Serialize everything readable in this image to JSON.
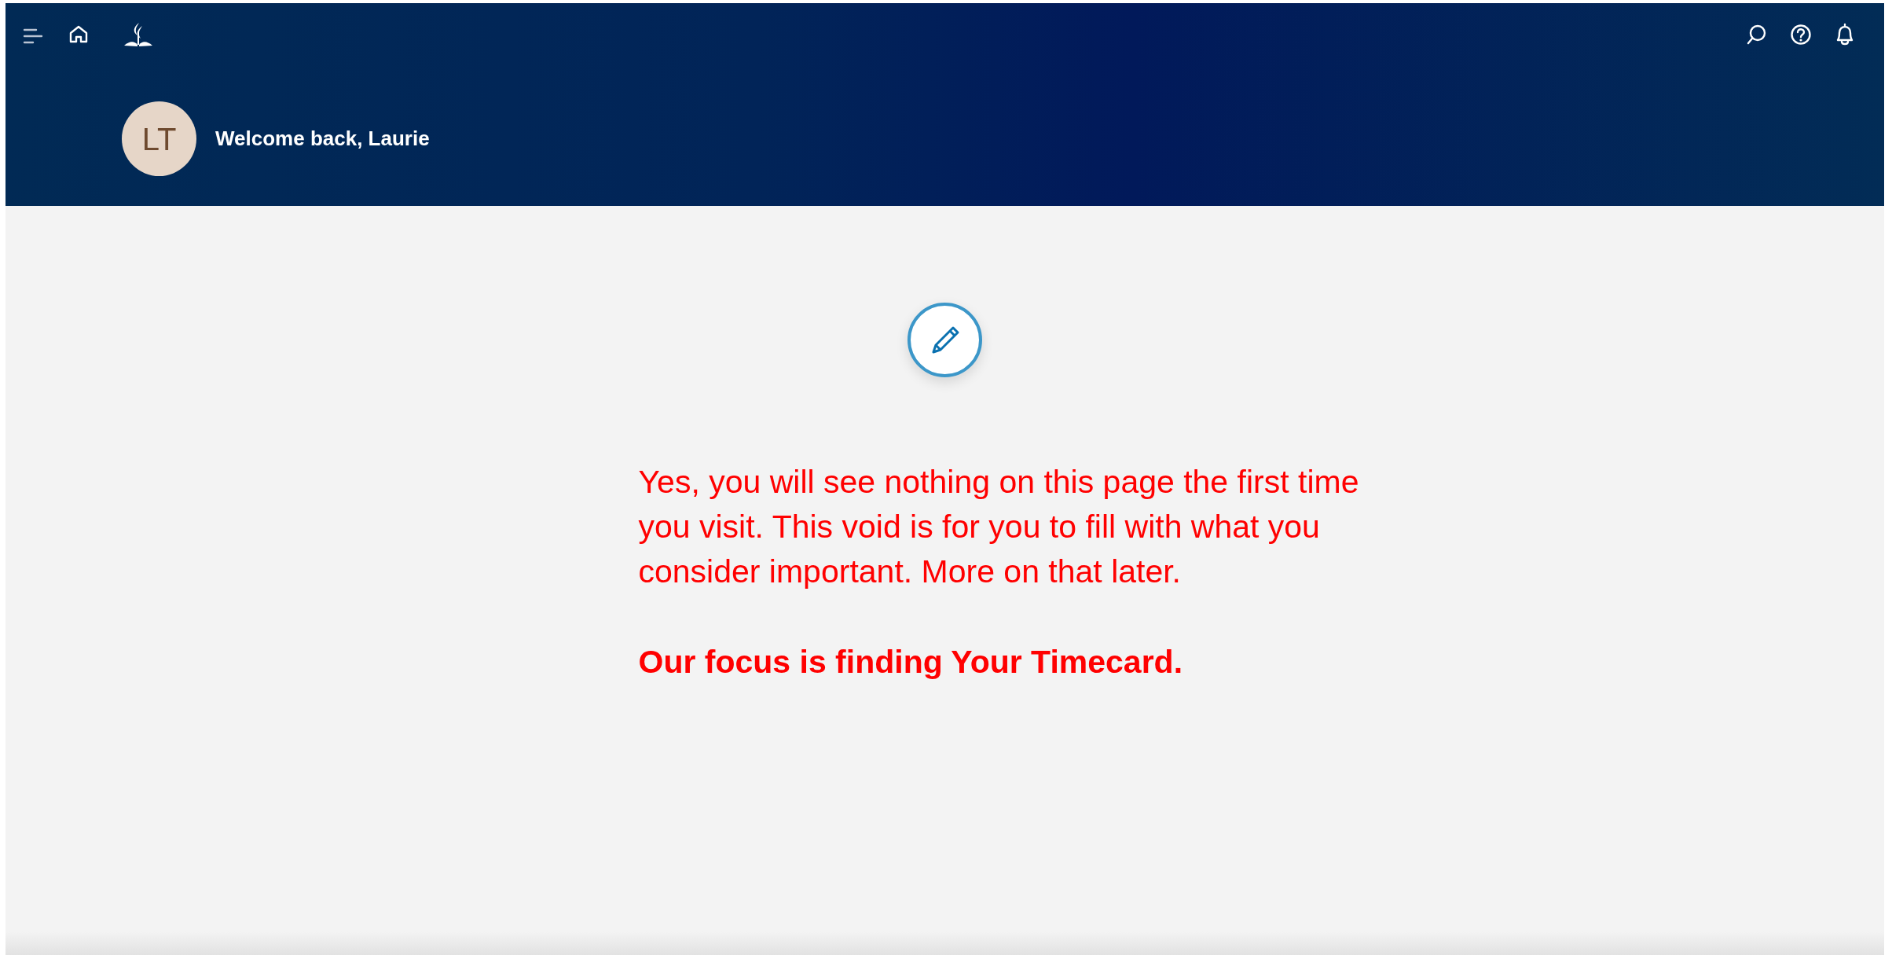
{
  "header": {
    "avatar_initials": "LT",
    "welcome": "Welcome back, Laurie"
  },
  "message": {
    "paragraph": "Yes, you will see nothing on this page the first time you visit. This void is for you to fill with what you consider important. More on that later.",
    "emphasis": "Our focus is finding Your Timecard."
  }
}
